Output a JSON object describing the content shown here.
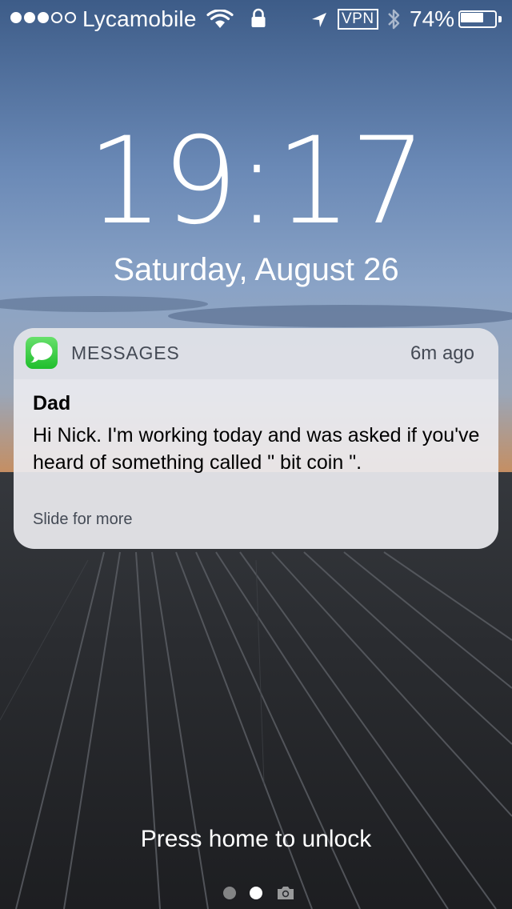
{
  "status_bar": {
    "signal_bars_filled": 3,
    "signal_bars_total": 5,
    "carrier": "Lycamobile",
    "wifi_icon": "wifi-icon",
    "orientation_lock_icon": "lock-icon",
    "location_icon": "location-arrow-icon",
    "vpn_label": "VPN",
    "bluetooth_icon": "bluetooth-icon",
    "battery_percent_label": "74%",
    "battery_level": 0.74
  },
  "lock_screen": {
    "time": "19:17",
    "date": "Saturday, August 26"
  },
  "notification": {
    "app_icon": "messages-icon",
    "app_name": "MESSAGES",
    "time_ago": "6m ago",
    "sender": "Dad",
    "body": "Hi Nick. I'm working today and was asked if you've heard of something called \" bit coin \".",
    "hint": "Slide for more"
  },
  "footer": {
    "unlock_text": "Press home to unlock",
    "pages_total": 2,
    "active_page": 2,
    "camera_icon": "camera-icon"
  },
  "colors": {
    "sky_top": "#3f5f8c",
    "sky_mid": "#7f9bc2",
    "ground": "#242629",
    "notification_bg": "#ececf0",
    "messages_green": "#34c747"
  }
}
